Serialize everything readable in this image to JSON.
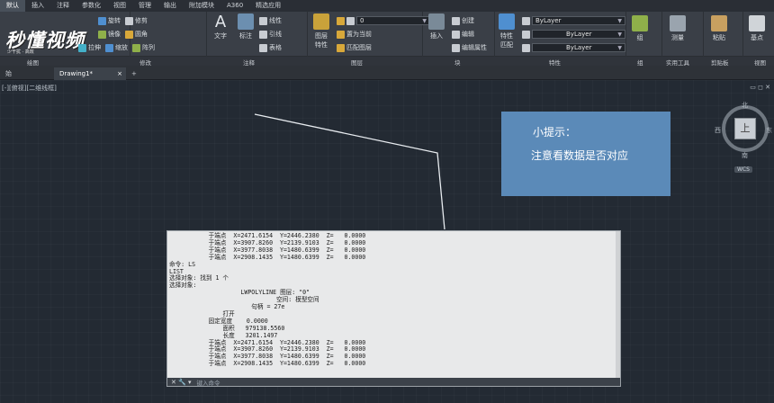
{
  "menu_tabs": [
    "默认",
    "插入",
    "注释",
    "参数化",
    "视图",
    "管理",
    "输出",
    "附加模块",
    "A360",
    "精选应用"
  ],
  "logo": {
    "text": "秒懂视频",
    "sub": "少干扰 · 高效"
  },
  "ribbon": {
    "draw_panel": {
      "stretch": "拉伸",
      "tools_row1": "旋转"
    },
    "modify_panel": {
      "row1": [
        "旋转",
        "修剪"
      ],
      "row2": [
        "镜像",
        "圆角"
      ],
      "row3": [
        "拉伸",
        "缩放",
        "阵列"
      ]
    },
    "annotation_panel": {
      "text": "文字",
      "dimension": "标注",
      "linear": "线性",
      "leader": "引线",
      "table": "表格"
    },
    "layers_panel": {
      "properties": "图层",
      "properties2": "特性",
      "layer_name": "0",
      "set_current": "置为当前",
      "match_layer": "匹配图层"
    },
    "block_panel": {
      "insert": "插入",
      "create": "创建",
      "edit": "编辑",
      "edit_attr": "编辑属性"
    },
    "properties_panel": {
      "match_props": "特性",
      "match_props2": "匹配",
      "color": "ByLayer",
      "linetype": "ByLayer",
      "lineweight": "ByLayer"
    },
    "groups_panel": {
      "group": "组"
    },
    "utilities_panel": {
      "measure": "测量"
    },
    "clipboard_panel": {
      "paste": "粘贴"
    },
    "view_panel": {
      "base": "基点"
    }
  },
  "panel_titles": [
    "绘图",
    "修改",
    "注释",
    "图层",
    "块",
    "特性",
    "组",
    "实用工具",
    "剪贴板",
    "视图"
  ],
  "doc_tabs": {
    "start": "始",
    "drawing": "Drawing1*",
    "add": "+"
  },
  "viewport_label": "[-][俯视][二维线框]",
  "viewcube": {
    "north": "北",
    "south": "南",
    "west": "西",
    "east": "东",
    "face": "上",
    "wcs": "WCS"
  },
  "tip": {
    "title": "小提示：",
    "body": "注意看数据是否对应"
  },
  "text_window_lines": [
    "           于端点  X=2471.6154  Y=2446.2380  Z=   0.0000",
    "           于端点  X=3907.8260  Y=2139.9103  Z=   0.0000",
    "           于端点  X=3977.8038  Y=1480.6399  Z=   0.0000",
    "           于端点  X=2908.1435  Y=1480.6399  Z=   0.0000",
    "命令: LS",
    "LIST",
    "选择对象: 找到 1 个",
    "选择对象:",
    "                    LWPOLYLINE 图层: \"0\"",
    "                              空间: 模型空间",
    "                       句柄 = 27e",
    "               打开",
    "           固定宽度    0.0000",
    "               面积   979138.5560",
    "               长度   3201.1497",
    "           于端点  X=2471.6154  Y=2446.2380  Z=   0.0000",
    "           于端点  X=3907.8260  Y=2139.9103  Z=   0.0000",
    "           于端点  X=3977.8038  Y=1480.6399  Z=   0.0000",
    "           于端点  X=2908.1435  Y=1480.6399  Z=   0.0000"
  ],
  "command": {
    "buttons": "✕  🔧  ▾",
    "placeholder": "键入命令"
  },
  "colors": {
    "tip_bg": "#5b8ab8",
    "canvas_bg": "#232a33",
    "ribbon_bg": "#3a3f47"
  }
}
